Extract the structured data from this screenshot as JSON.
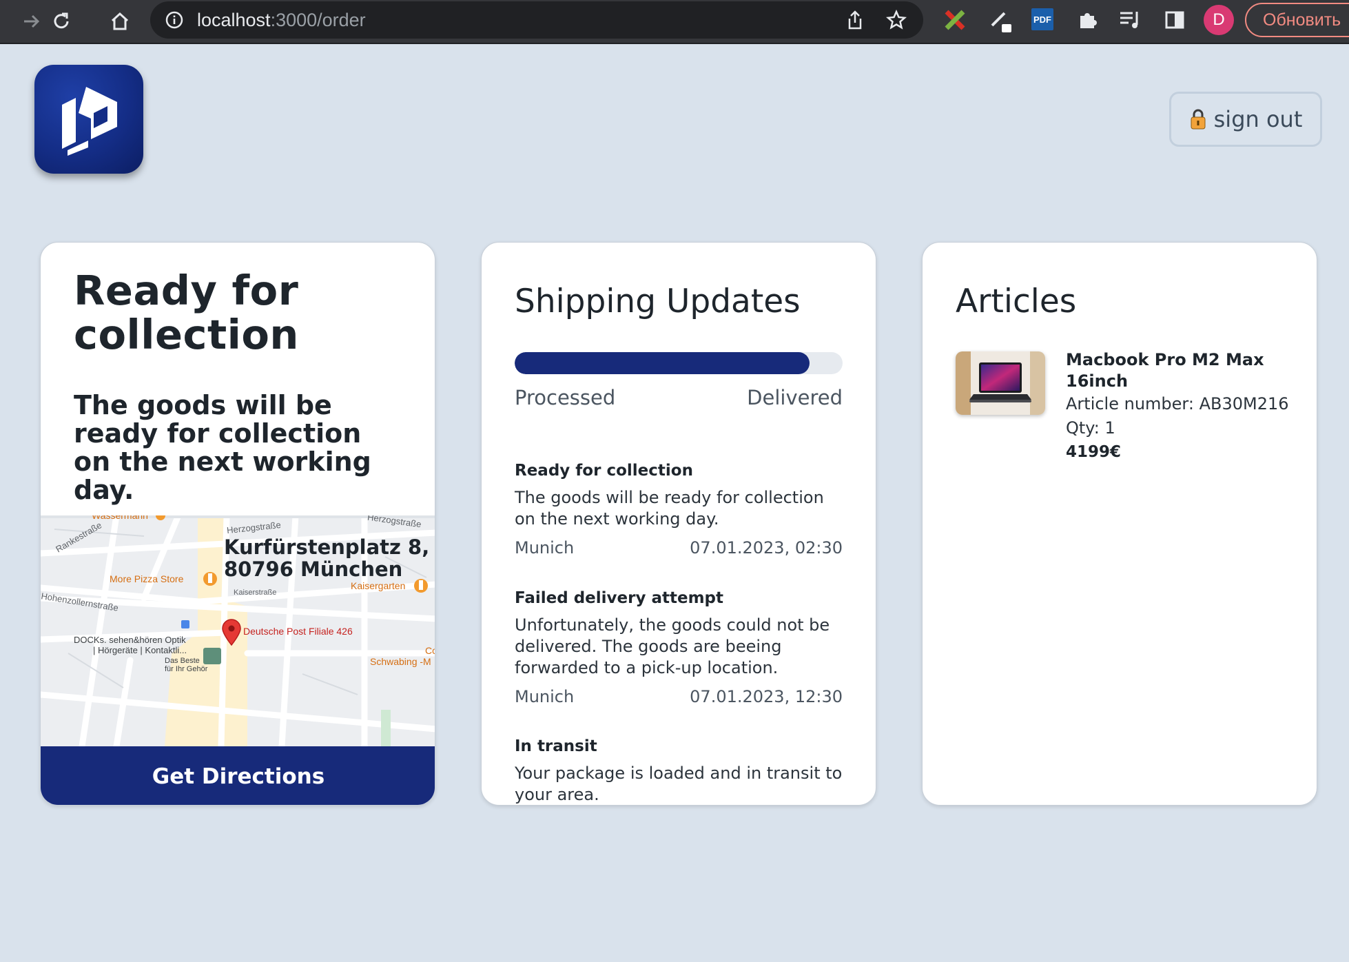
{
  "browser": {
    "url_host": "localhost",
    "url_path": ":3000/order",
    "pdf_label": "PDF",
    "profile_initial": "D",
    "update_label": "Обновить"
  },
  "header": {
    "sign_out_label": "sign out"
  },
  "status_card": {
    "title": "Ready for collection",
    "description": "The goods will be ready for collection on the next working day.",
    "map": {
      "address": "Kurfürstenplatz 8, 80796 München",
      "labels": {
        "wassermann": "Wassermann",
        "herzogstrasse_1": "Herzogstraße",
        "herzogstrasse_2": "Herzogstraße",
        "rankestrasse": "Rankestraße",
        "more_pizza": "More Pizza Store",
        "kaisergarten": "Kaisergarten",
        "kaiserstrasse": "Kaiserstraße",
        "hohenzollernstrasse": "Hohenzollernstraße",
        "post": "Deutsche Post Filiale 426",
        "docks_1": "DOCKs. sehen&hören Optik",
        "docks_2": "| Hörgeräte | Kontaktli...",
        "docks_3": "Das Beste",
        "docks_4": "für Ihr Gehör",
        "schwabing": "Schwabing -M",
        "co": "Co"
      }
    },
    "directions_label": "Get Directions"
  },
  "shipping": {
    "title": "Shipping Updates",
    "progress": {
      "start_label": "Processed",
      "end_label": "Delivered",
      "fill_fraction": 0.9
    },
    "updates": [
      {
        "title": "Ready for collection",
        "text": "The goods will be ready for collection on the next working day.",
        "location": "Munich",
        "timestamp": "07.01.2023, 02:30"
      },
      {
        "title": "Failed delivery attempt",
        "text": "Unfortunately, the goods could not be delivered. The goods are beeing forwarded to a pick-up location.",
        "location": "Munich",
        "timestamp": "07.01.2023, 12:30"
      },
      {
        "title": "In transit",
        "text": "Your package is loaded and in transit to your area."
      }
    ]
  },
  "articles": {
    "title": "Articles",
    "items": [
      {
        "name": "Macbook Pro M2 Max 16inch",
        "article_number": "Article number: AB30M216",
        "qty": "Qty: 1",
        "price": "4199€"
      }
    ]
  },
  "colors": {
    "background": "#d9e2ec",
    "brand_navy": "#172a7a",
    "card": "#ffffff",
    "browser_chrome": "#35363a"
  }
}
